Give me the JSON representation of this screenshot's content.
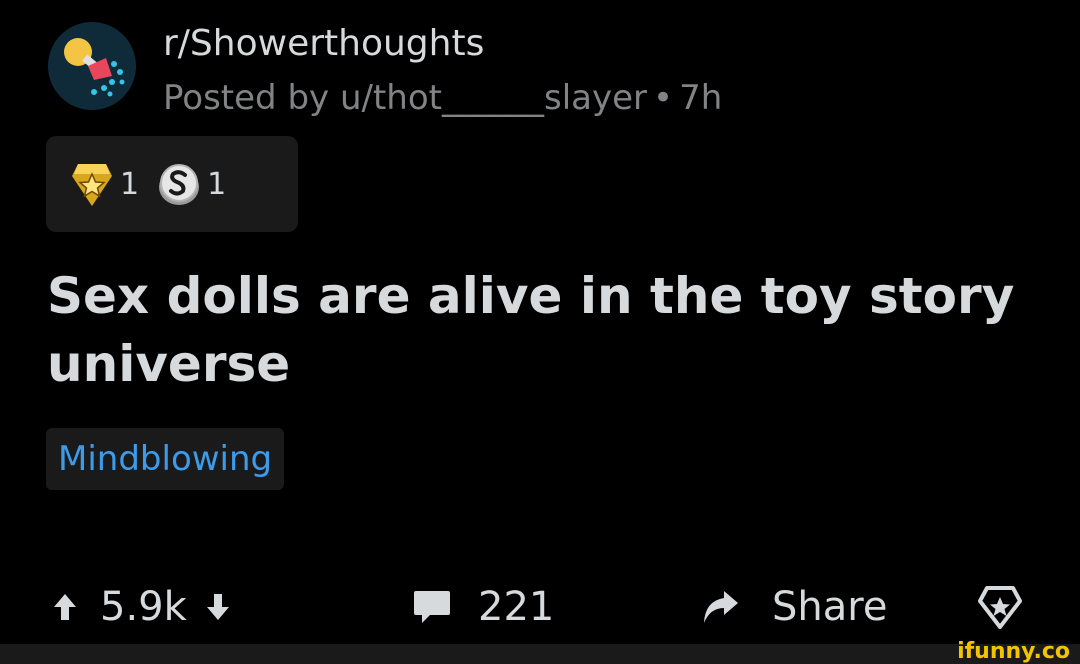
{
  "post": {
    "subreddit": "r/Showerthoughts",
    "posted_prefix": "Posted by",
    "author": "u/thot______slayer",
    "separator": "•",
    "age": "7h",
    "title": "Sex dolls are alive in the toy story universe",
    "flair": "Mindblowing"
  },
  "awards": [
    {
      "icon": "star-award-icon",
      "count": "1"
    },
    {
      "icon": "silver-award-icon",
      "count": "1"
    }
  ],
  "actions": {
    "score": "5.9k",
    "comments": "221",
    "share_label": "Share"
  },
  "colors": {
    "background": "#000000",
    "text": "#d7dadc",
    "muted": "#818384",
    "flair": "#3d9be9",
    "award_box": "#1a1a1b",
    "watermark": "#f2c400"
  },
  "watermark": "ifunny.co"
}
